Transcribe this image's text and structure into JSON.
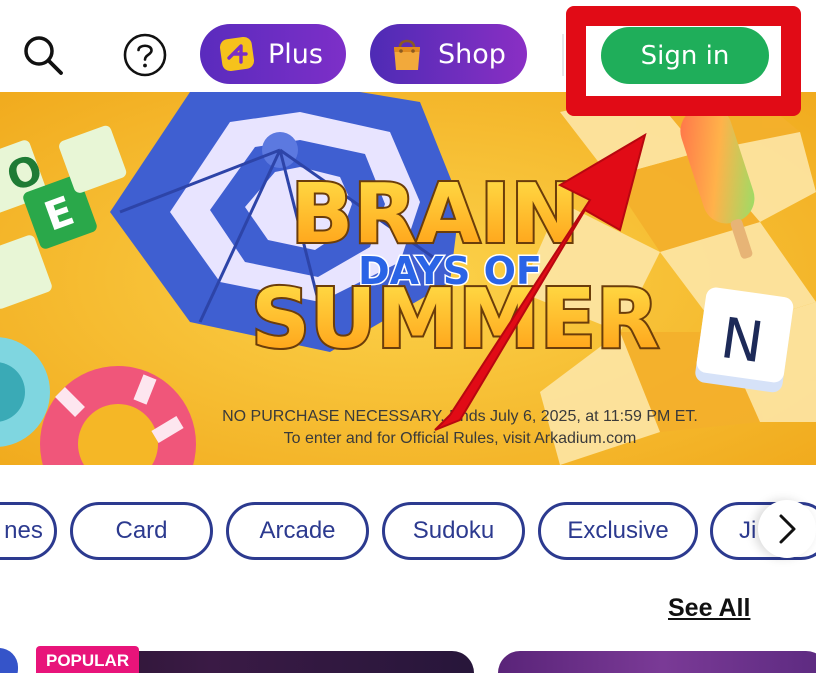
{
  "header": {
    "search_icon": "search-icon",
    "help_icon": "help-icon",
    "plus_label": "Plus",
    "shop_label": "Shop",
    "signin_label": "Sign in"
  },
  "banner": {
    "title_line1": "BRAIN",
    "title_line2": "DAYS OF",
    "title_line3": "SUMMER",
    "tile_letters": [
      "O",
      "E",
      "N"
    ],
    "legal_line1": "NO PURCHASE NECESSARY. Ends July 6, 2025, at 11:59 PM ET.",
    "legal_line2": "To enter and for Official Rules, visit Arkadium.com"
  },
  "categories": {
    "items": [
      "nes",
      "Card",
      "Arcade",
      "Sudoku",
      "Exclusive",
      "Ji"
    ],
    "next_icon": "chevron-right-icon"
  },
  "section": {
    "see_all_label": "See All"
  },
  "cards": {
    "badge_label": "POPULAR"
  },
  "colors": {
    "signin_green": "#1fae5a",
    "highlight_red": "#e10b16",
    "chip_border": "#2c3a8f",
    "plus_purple": "#5a2bbd",
    "popular_pink": "#e8147a"
  }
}
